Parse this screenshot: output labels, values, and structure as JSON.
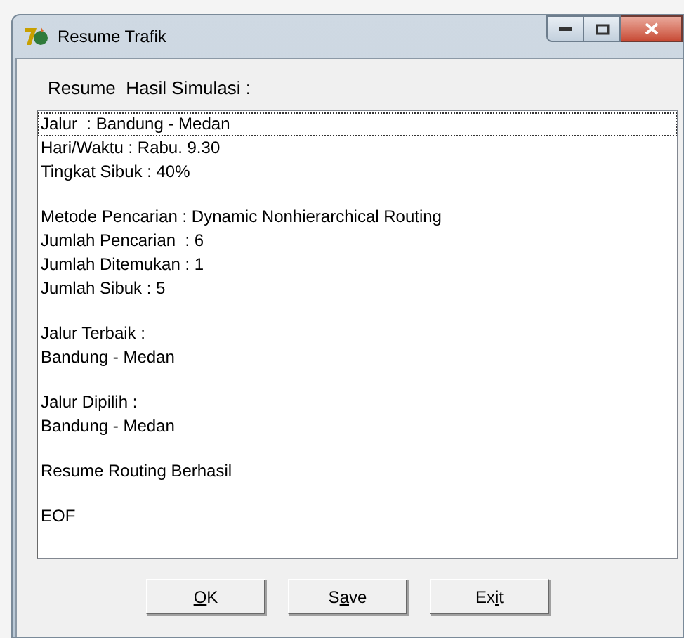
{
  "window": {
    "title": "Resume Trafik"
  },
  "heading": "Resume  Hasil Simulasi :",
  "groups": [
    {
      "lines": [
        {
          "text": "Jalur  : Bandung - Medan",
          "selected": true
        },
        {
          "text": "Hari/Waktu : Rabu. 9.30",
          "selected": false
        },
        {
          "text": "Tingkat Sibuk : 40%",
          "selected": false
        }
      ]
    },
    {
      "lines": [
        {
          "text": "Metode Pencarian : Dynamic Nonhierarchical Routing",
          "selected": false
        },
        {
          "text": "Jumlah Pencarian  : 6",
          "selected": false
        },
        {
          "text": "Jumlah Ditemukan : 1",
          "selected": false
        },
        {
          "text": "Jumlah Sibuk : 5",
          "selected": false
        }
      ]
    },
    {
      "lines": [
        {
          "text": "Jalur Terbaik :",
          "selected": false
        },
        {
          "text": "Bandung - Medan",
          "selected": false
        }
      ]
    },
    {
      "lines": [
        {
          "text": "Jalur Dipilih :",
          "selected": false
        },
        {
          "text": "Bandung - Medan",
          "selected": false
        }
      ]
    },
    {
      "lines": [
        {
          "text": "Resume Routing Berhasil",
          "selected": false
        }
      ]
    },
    {
      "lines": [
        {
          "text": "EOF",
          "selected": false
        }
      ]
    }
  ],
  "buttons": [
    {
      "parts": [
        {
          "text": "O",
          "underlined": true
        },
        {
          "text": "K",
          "underlined": false
        }
      ]
    },
    {
      "parts": [
        {
          "text": "S",
          "underlined": false
        },
        {
          "text": "a",
          "underlined": true
        },
        {
          "text": "ve",
          "underlined": false
        }
      ]
    },
    {
      "parts": [
        {
          "text": "Ex",
          "underlined": false
        },
        {
          "text": "i",
          "underlined": true
        },
        {
          "text": "t",
          "underlined": false
        }
      ]
    }
  ]
}
